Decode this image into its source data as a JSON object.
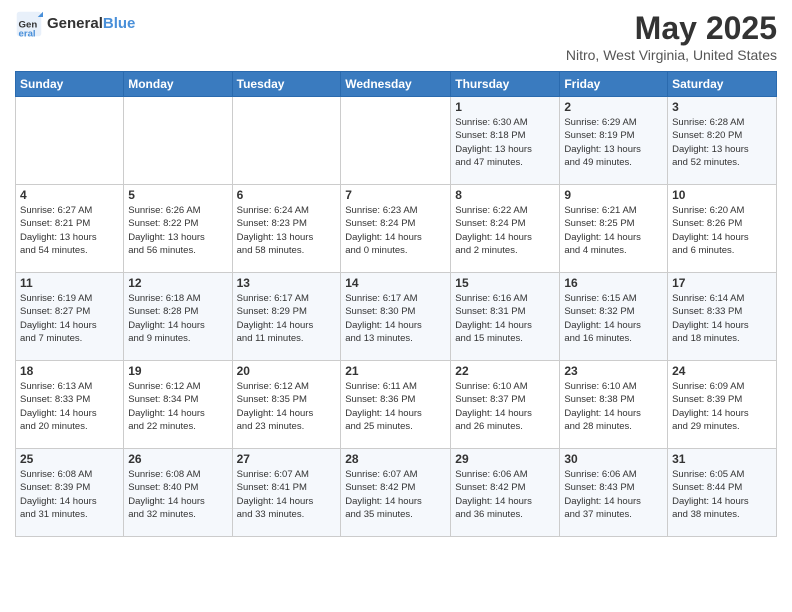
{
  "logo": {
    "text_general": "General",
    "text_blue": "Blue"
  },
  "header": {
    "title": "May 2025",
    "subtitle": "Nitro, West Virginia, United States"
  },
  "weekdays": [
    "Sunday",
    "Monday",
    "Tuesday",
    "Wednesday",
    "Thursday",
    "Friday",
    "Saturday"
  ],
  "weeks": [
    [
      {
        "day": "",
        "info": ""
      },
      {
        "day": "",
        "info": ""
      },
      {
        "day": "",
        "info": ""
      },
      {
        "day": "",
        "info": ""
      },
      {
        "day": "1",
        "info": "Sunrise: 6:30 AM\nSunset: 8:18 PM\nDaylight: 13 hours\nand 47 minutes."
      },
      {
        "day": "2",
        "info": "Sunrise: 6:29 AM\nSunset: 8:19 PM\nDaylight: 13 hours\nand 49 minutes."
      },
      {
        "day": "3",
        "info": "Sunrise: 6:28 AM\nSunset: 8:20 PM\nDaylight: 13 hours\nand 52 minutes."
      }
    ],
    [
      {
        "day": "4",
        "info": "Sunrise: 6:27 AM\nSunset: 8:21 PM\nDaylight: 13 hours\nand 54 minutes."
      },
      {
        "day": "5",
        "info": "Sunrise: 6:26 AM\nSunset: 8:22 PM\nDaylight: 13 hours\nand 56 minutes."
      },
      {
        "day": "6",
        "info": "Sunrise: 6:24 AM\nSunset: 8:23 PM\nDaylight: 13 hours\nand 58 minutes."
      },
      {
        "day": "7",
        "info": "Sunrise: 6:23 AM\nSunset: 8:24 PM\nDaylight: 14 hours\nand 0 minutes."
      },
      {
        "day": "8",
        "info": "Sunrise: 6:22 AM\nSunset: 8:24 PM\nDaylight: 14 hours\nand 2 minutes."
      },
      {
        "day": "9",
        "info": "Sunrise: 6:21 AM\nSunset: 8:25 PM\nDaylight: 14 hours\nand 4 minutes."
      },
      {
        "day": "10",
        "info": "Sunrise: 6:20 AM\nSunset: 8:26 PM\nDaylight: 14 hours\nand 6 minutes."
      }
    ],
    [
      {
        "day": "11",
        "info": "Sunrise: 6:19 AM\nSunset: 8:27 PM\nDaylight: 14 hours\nand 7 minutes."
      },
      {
        "day": "12",
        "info": "Sunrise: 6:18 AM\nSunset: 8:28 PM\nDaylight: 14 hours\nand 9 minutes."
      },
      {
        "day": "13",
        "info": "Sunrise: 6:17 AM\nSunset: 8:29 PM\nDaylight: 14 hours\nand 11 minutes."
      },
      {
        "day": "14",
        "info": "Sunrise: 6:17 AM\nSunset: 8:30 PM\nDaylight: 14 hours\nand 13 minutes."
      },
      {
        "day": "15",
        "info": "Sunrise: 6:16 AM\nSunset: 8:31 PM\nDaylight: 14 hours\nand 15 minutes."
      },
      {
        "day": "16",
        "info": "Sunrise: 6:15 AM\nSunset: 8:32 PM\nDaylight: 14 hours\nand 16 minutes."
      },
      {
        "day": "17",
        "info": "Sunrise: 6:14 AM\nSunset: 8:33 PM\nDaylight: 14 hours\nand 18 minutes."
      }
    ],
    [
      {
        "day": "18",
        "info": "Sunrise: 6:13 AM\nSunset: 8:33 PM\nDaylight: 14 hours\nand 20 minutes."
      },
      {
        "day": "19",
        "info": "Sunrise: 6:12 AM\nSunset: 8:34 PM\nDaylight: 14 hours\nand 22 minutes."
      },
      {
        "day": "20",
        "info": "Sunrise: 6:12 AM\nSunset: 8:35 PM\nDaylight: 14 hours\nand 23 minutes."
      },
      {
        "day": "21",
        "info": "Sunrise: 6:11 AM\nSunset: 8:36 PM\nDaylight: 14 hours\nand 25 minutes."
      },
      {
        "day": "22",
        "info": "Sunrise: 6:10 AM\nSunset: 8:37 PM\nDaylight: 14 hours\nand 26 minutes."
      },
      {
        "day": "23",
        "info": "Sunrise: 6:10 AM\nSunset: 8:38 PM\nDaylight: 14 hours\nand 28 minutes."
      },
      {
        "day": "24",
        "info": "Sunrise: 6:09 AM\nSunset: 8:39 PM\nDaylight: 14 hours\nand 29 minutes."
      }
    ],
    [
      {
        "day": "25",
        "info": "Sunrise: 6:08 AM\nSunset: 8:39 PM\nDaylight: 14 hours\nand 31 minutes."
      },
      {
        "day": "26",
        "info": "Sunrise: 6:08 AM\nSunset: 8:40 PM\nDaylight: 14 hours\nand 32 minutes."
      },
      {
        "day": "27",
        "info": "Sunrise: 6:07 AM\nSunset: 8:41 PM\nDaylight: 14 hours\nand 33 minutes."
      },
      {
        "day": "28",
        "info": "Sunrise: 6:07 AM\nSunset: 8:42 PM\nDaylight: 14 hours\nand 35 minutes."
      },
      {
        "day": "29",
        "info": "Sunrise: 6:06 AM\nSunset: 8:42 PM\nDaylight: 14 hours\nand 36 minutes."
      },
      {
        "day": "30",
        "info": "Sunrise: 6:06 AM\nSunset: 8:43 PM\nDaylight: 14 hours\nand 37 minutes."
      },
      {
        "day": "31",
        "info": "Sunrise: 6:05 AM\nSunset: 8:44 PM\nDaylight: 14 hours\nand 38 minutes."
      }
    ]
  ]
}
